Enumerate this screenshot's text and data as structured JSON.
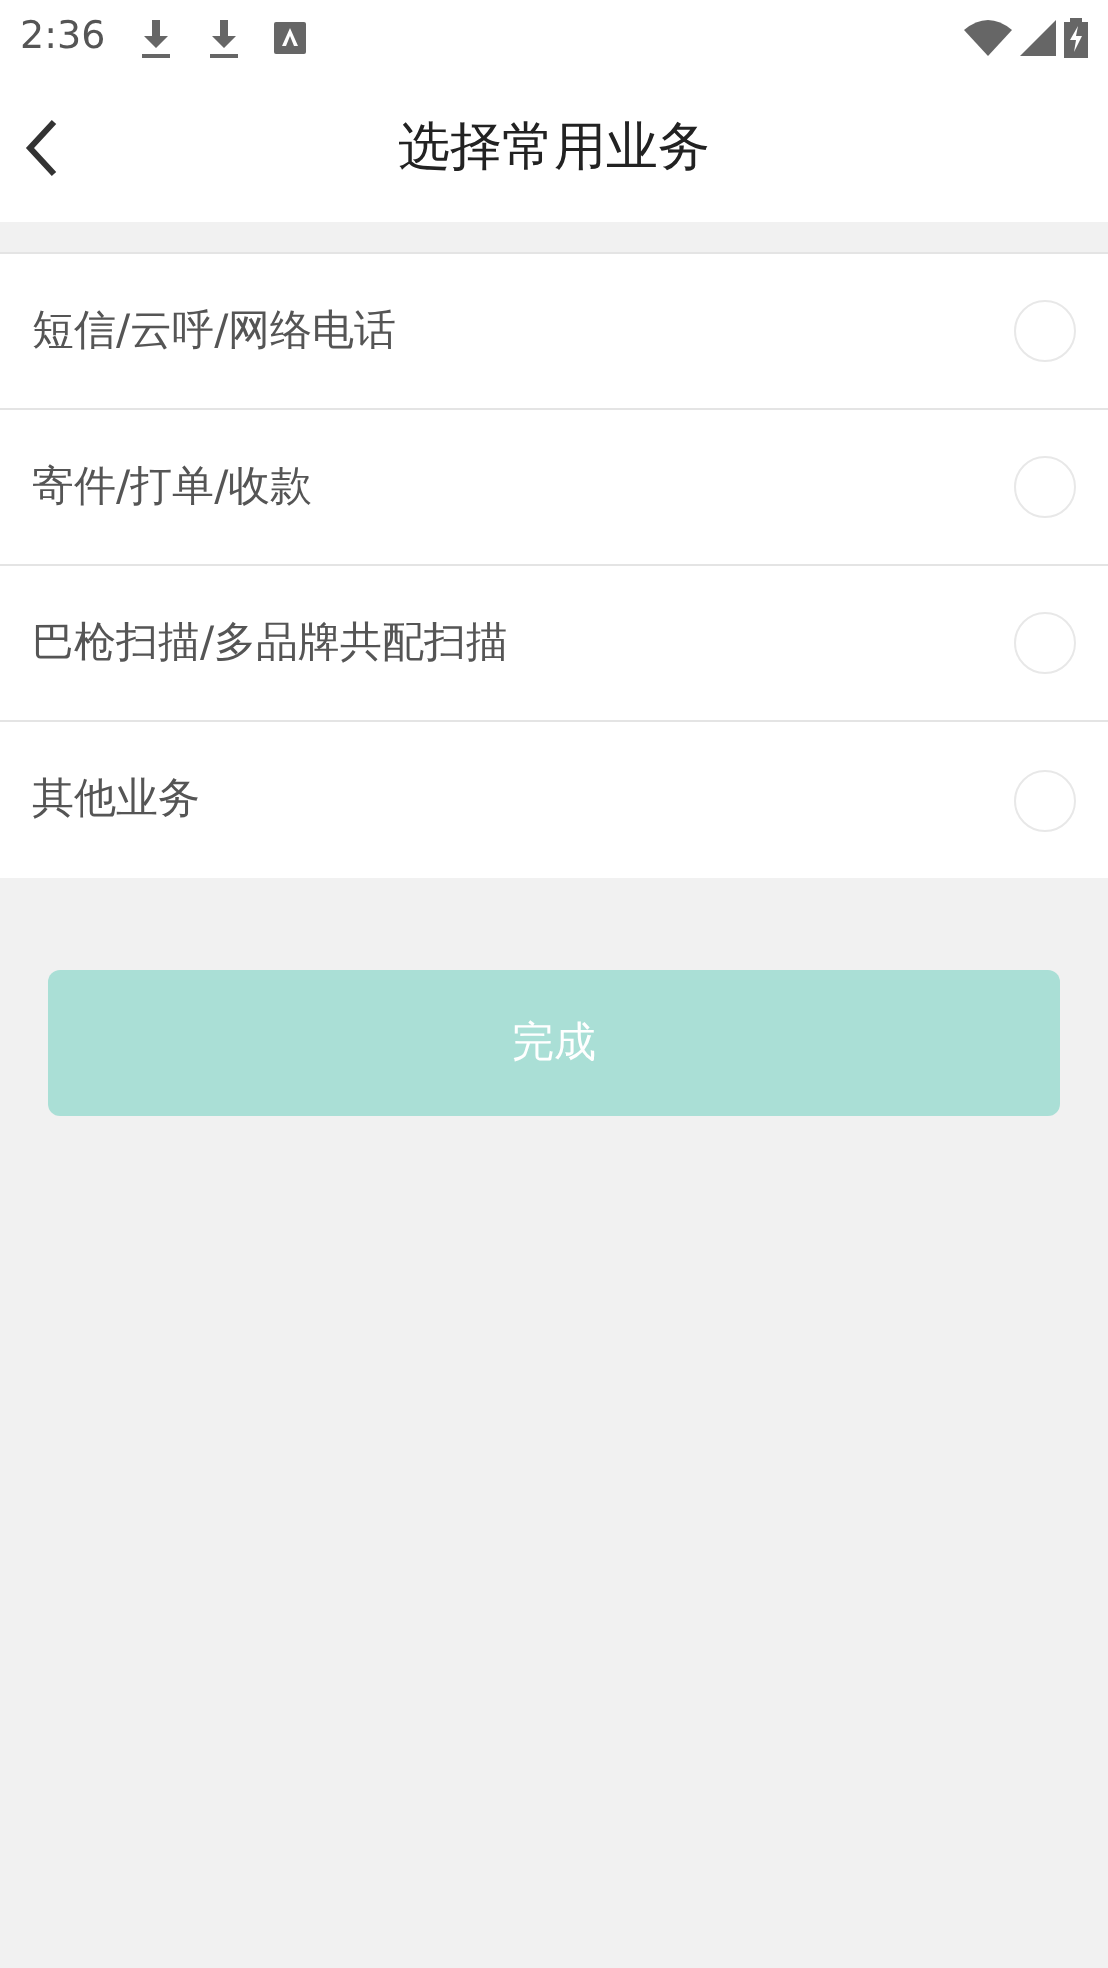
{
  "status_bar": {
    "time": "2:36"
  },
  "header": {
    "title": "选择常用业务"
  },
  "options": [
    {
      "label": "短信/云呼/网络电话",
      "selected": false
    },
    {
      "label": "寄件/打单/收款",
      "selected": false
    },
    {
      "label": "巴枪扫描/多品牌共配扫描",
      "selected": false
    },
    {
      "label": "其他业务",
      "selected": false
    }
  ],
  "done_button": {
    "label": "完成",
    "disabled": true
  }
}
